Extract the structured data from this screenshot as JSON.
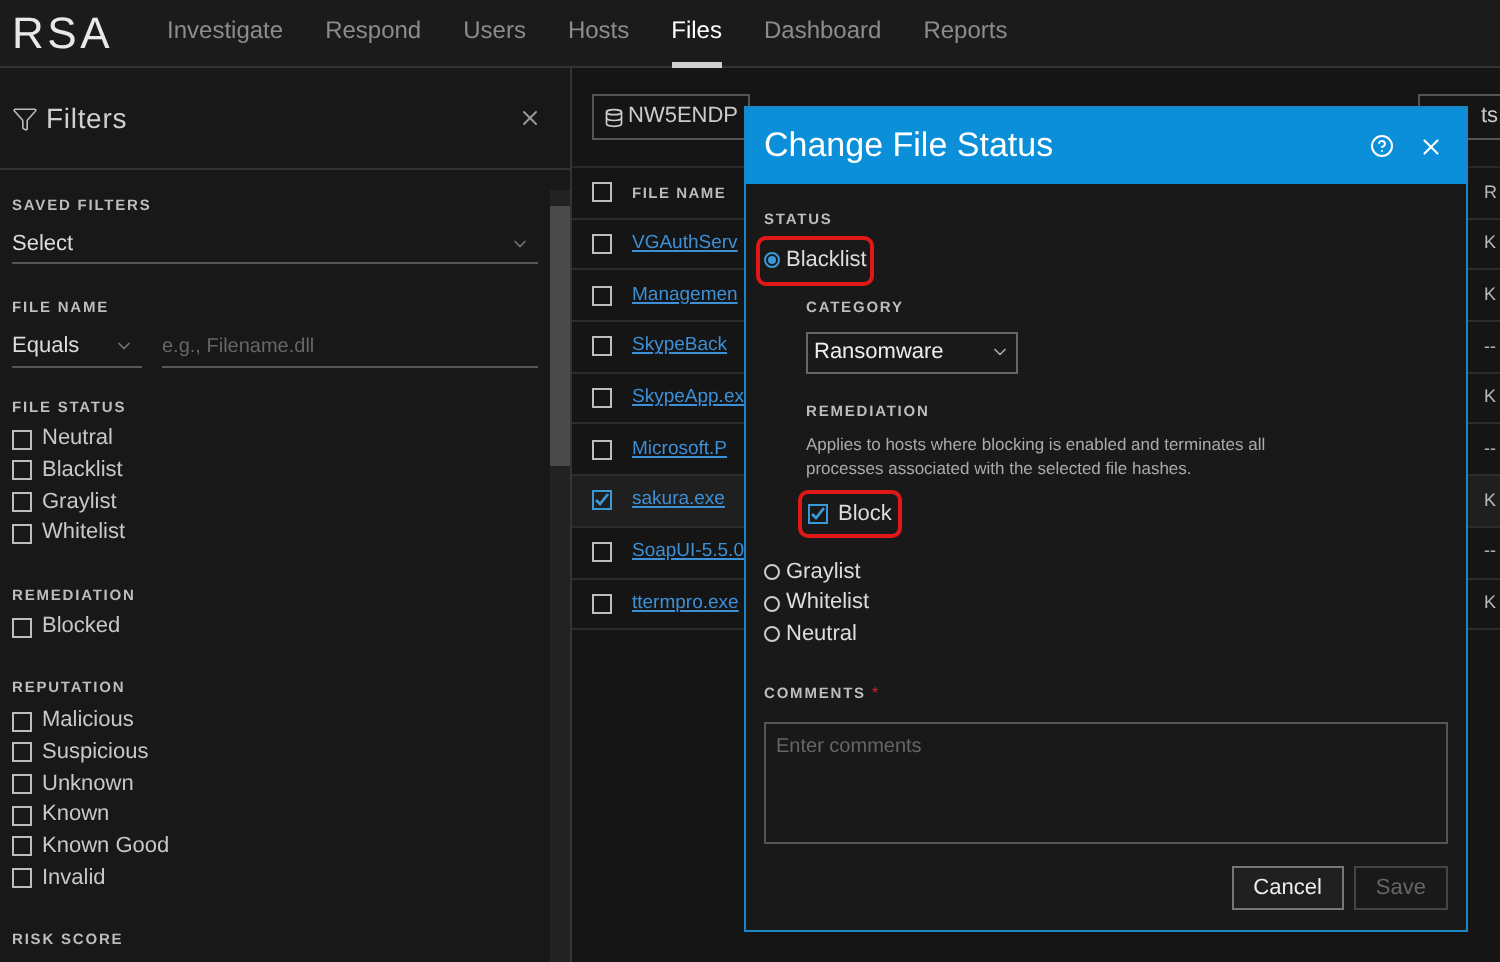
{
  "nav": {
    "logo": "RSA",
    "items": [
      {
        "label": "Investigate",
        "selected": false
      },
      {
        "label": "Respond",
        "selected": false
      },
      {
        "label": "Users",
        "selected": false
      },
      {
        "label": "Hosts",
        "selected": false
      },
      {
        "label": "Files",
        "selected": true
      },
      {
        "label": "Dashboard",
        "selected": false
      },
      {
        "label": "Reports",
        "selected": false
      }
    ]
  },
  "filters": {
    "title": "Filters",
    "saved_filters": {
      "label": "SAVED FILTERS",
      "value": "Select"
    },
    "file_name": {
      "label": "FILE NAME",
      "operator": "Equals",
      "placeholder": "e.g., Filename.dll"
    },
    "groups": [
      {
        "label": "FILE STATUS",
        "options": [
          {
            "label": "Neutral",
            "checked": false
          },
          {
            "label": "Blacklist",
            "checked": false
          },
          {
            "label": "Graylist",
            "checked": false
          },
          {
            "label": "Whitelist",
            "checked": false
          }
        ]
      },
      {
        "label": "REMEDIATION",
        "options": [
          {
            "label": "Blocked",
            "checked": false
          }
        ]
      },
      {
        "label": "REPUTATION",
        "options": [
          {
            "label": "Malicious",
            "checked": false
          },
          {
            "label": "Suspicious",
            "checked": false
          },
          {
            "label": "Unknown",
            "checked": false
          },
          {
            "label": "Known",
            "checked": false
          },
          {
            "label": "Known Good",
            "checked": false
          },
          {
            "label": "Invalid",
            "checked": false
          }
        ]
      },
      {
        "label": "RISK SCORE"
      }
    ]
  },
  "toolbar": {
    "service_button": "NW5ENDP",
    "right_button": "ts"
  },
  "table": {
    "columns": [
      "FILE NAME",
      "R"
    ],
    "select_all_checked": false,
    "rows": [
      {
        "file": "VGAuthServ",
        "column_2": "K",
        "checked": false
      },
      {
        "file": "Managemen",
        "column_2": "K",
        "checked": false
      },
      {
        "file": "SkypeBack",
        "column_2": "--",
        "checked": false
      },
      {
        "file": "SkypeApp.ex",
        "column_2": "K",
        "checked": false
      },
      {
        "file": "Microsoft.P",
        "column_2": "--",
        "checked": false
      },
      {
        "file": "sakura.exe",
        "column_2": "K",
        "checked": true
      },
      {
        "file": "SoapUI-5.5.0",
        "column_2": "--",
        "checked": false
      },
      {
        "file": "ttermpro.exe",
        "column_2": "K",
        "checked": false
      }
    ]
  },
  "dialog": {
    "title": "Change File Status",
    "status_label": "STATUS",
    "options": [
      {
        "label": "Blacklist",
        "selected": true,
        "highlighted": true
      },
      {
        "label": "Graylist",
        "selected": false,
        "highlighted": false
      },
      {
        "label": "Whitelist",
        "selected": false,
        "highlighted": false
      },
      {
        "label": "Neutral",
        "selected": false,
        "highlighted": false
      }
    ],
    "category_label": "CATEGORY",
    "category": "Ransomware",
    "remediation_label": "REMEDIATION",
    "remediation_text": "Applies to hosts where blocking is enabled and terminates all processes associated with the selected file hashes.",
    "block": {
      "label": "Block",
      "checked": true,
      "highlighted": true
    },
    "comments_label": "COMMENTS",
    "required_mark": "*",
    "comments_placeholder": "Enter comments",
    "buttons": [
      {
        "label": "Cancel",
        "disabled": false
      },
      {
        "label": "Save",
        "disabled": true
      }
    ]
  }
}
